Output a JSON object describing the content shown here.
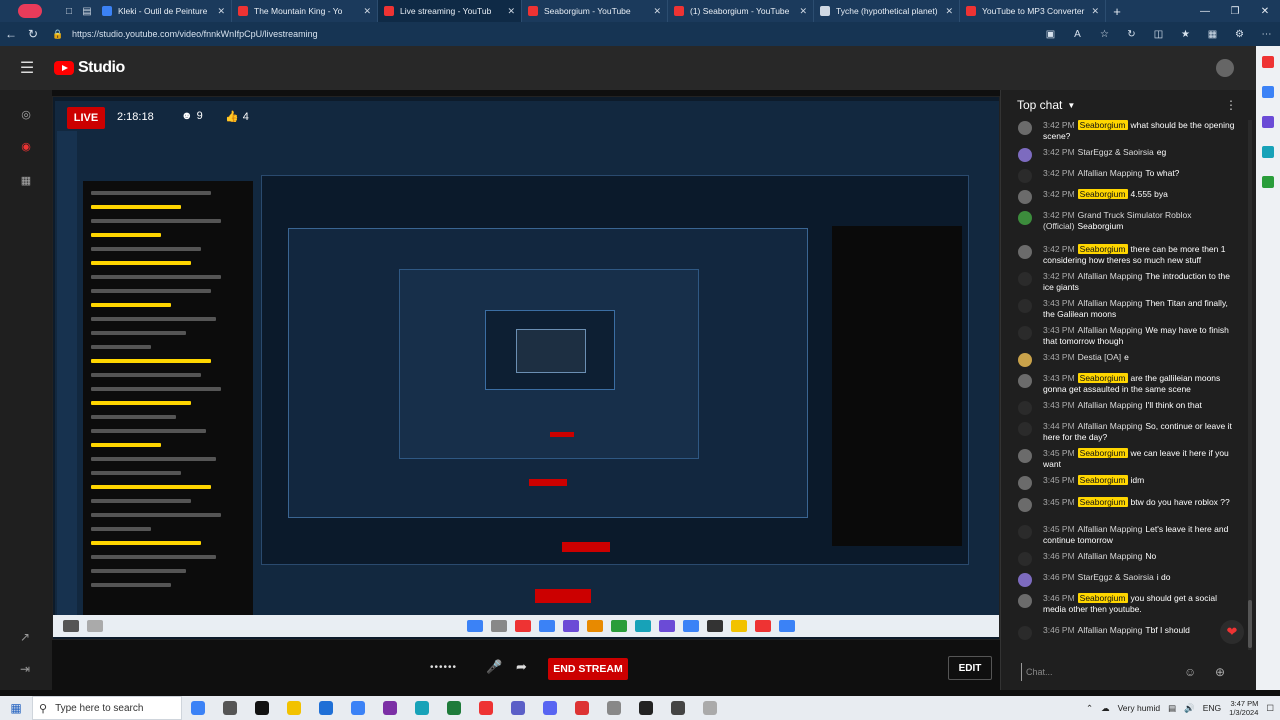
{
  "browser": {
    "tabs": [
      {
        "title": "Kleki - Outil de Peinture",
        "favicon": "kleki-icon"
      },
      {
        "title": "The Mountain King - Yo",
        "favicon": "youtube-icon"
      },
      {
        "title": "Live streaming - YouTub",
        "favicon": "studio-icon",
        "active": true
      },
      {
        "title": "Seaborgium - YouTube",
        "favicon": "youtube-icon"
      },
      {
        "title": "(1) Seaborgium - YouTube",
        "favicon": "youtube-icon"
      },
      {
        "title": "Tyche (hypothetical planet)",
        "favicon": "wikipedia-icon"
      },
      {
        "title": "YouTube to MP3 Converter",
        "favicon": "converter-icon"
      }
    ],
    "url": "https://studio.youtube.com/video/fnnkWnIfpCpU/livestreaming"
  },
  "studio": {
    "brand": "Studio"
  },
  "stream": {
    "live_label": "LIVE",
    "duration": "2:18:18",
    "viewers": "9",
    "likes": "4",
    "end_stream_label": "END STREAM",
    "edit_label": "EDIT",
    "dots": "••••••"
  },
  "chat": {
    "header": "Top chat",
    "input_placeholder": "Chat...",
    "messages": [
      {
        "time": "3:42 PM",
        "author": "Seaborgium",
        "owner": true,
        "text": "what should be the opening scene?",
        "avatar_color": "#6b6b6b"
      },
      {
        "time": "3:42 PM",
        "author": "StarEggz & Saoirsia",
        "owner": false,
        "text": "eg",
        "avatar_color": "#7d6bbf"
      },
      {
        "time": "3:42 PM",
        "author": "Alfallian Mapping",
        "owner": false,
        "text": "To what?",
        "avatar_color": "#2b2b2b"
      },
      {
        "time": "3:42 PM",
        "author": "Seaborgium",
        "owner": true,
        "text": "4.555 bya",
        "avatar_color": "#6b6b6b"
      },
      {
        "time": "3:42 PM",
        "author": "Grand Truck Simulator Roblox (Official)",
        "owner": false,
        "text": "Seaborgium",
        "avatar_color": "#3c8c3c"
      },
      {
        "time": "3:42 PM",
        "author": "Seaborgium",
        "owner": true,
        "text": "there can be more then 1 considering how theres so much new stuff",
        "avatar_color": "#6b6b6b"
      },
      {
        "time": "3:42 PM",
        "author": "Alfallian Mapping",
        "owner": false,
        "text": "The introduction to the ice giants",
        "avatar_color": "#2b2b2b"
      },
      {
        "time": "3:43 PM",
        "author": "Alfallian Mapping",
        "owner": false,
        "text": "Then Titan and finally, the Galilean moons",
        "avatar_color": "#2b2b2b"
      },
      {
        "time": "3:43 PM",
        "author": "Alfallian Mapping",
        "owner": false,
        "text": "We may have to finish that tomorrow though",
        "avatar_color": "#2b2b2b"
      },
      {
        "time": "3:43 PM",
        "author": "Destia [OA]",
        "owner": false,
        "text": "e",
        "avatar_color": "#c9a24a"
      },
      {
        "time": "3:43 PM",
        "author": "Seaborgium",
        "owner": true,
        "text": "are the gallileian moons gonna get assaulted in the same scene",
        "avatar_color": "#6b6b6b"
      },
      {
        "time": "3:43 PM",
        "author": "Alfallian Mapping",
        "owner": false,
        "text": "I'll think on that",
        "avatar_color": "#2b2b2b"
      },
      {
        "time": "3:44 PM",
        "author": "Alfallian Mapping",
        "owner": false,
        "text": "So, continue or leave it here for the day?",
        "avatar_color": "#2b2b2b"
      },
      {
        "time": "3:45 PM",
        "author": "Seaborgium",
        "owner": true,
        "text": "we can leave it here if you want",
        "avatar_color": "#6b6b6b"
      },
      {
        "time": "3:45 PM",
        "author": "Seaborgium",
        "owner": true,
        "text": "idm",
        "avatar_color": "#6b6b6b"
      },
      {
        "time": "3:45 PM",
        "author": "Seaborgium",
        "owner": true,
        "text": "btw do you have roblox ??",
        "avatar_color": "#6b6b6b"
      },
      {
        "time": "3:45 PM",
        "author": "Alfallian Mapping",
        "owner": false,
        "text": "Let's leave it here and continue tomorrow",
        "avatar_color": "#2b2b2b"
      },
      {
        "time": "3:46 PM",
        "author": "Alfallian Mapping",
        "owner": false,
        "text": "No",
        "avatar_color": "#2b2b2b"
      },
      {
        "time": "3:46 PM",
        "author": "StarEggz & Saoirsia",
        "owner": false,
        "text": "i do",
        "avatar_color": "#7d6bbf"
      },
      {
        "time": "3:46 PM",
        "author": "Seaborgium",
        "owner": true,
        "text": "you should get a social media other then youtube.",
        "avatar_color": "#6b6b6b"
      },
      {
        "time": "3:46 PM",
        "author": "Alfallian Mapping",
        "owner": false,
        "text": "Tbf I should",
        "avatar_color": "#2b2b2b"
      }
    ]
  },
  "taskbar": {
    "search_placeholder": "Type here to search",
    "weather": "Very humid",
    "language": "ENG",
    "time": "3:47 PM",
    "date": "1/3/2024"
  }
}
